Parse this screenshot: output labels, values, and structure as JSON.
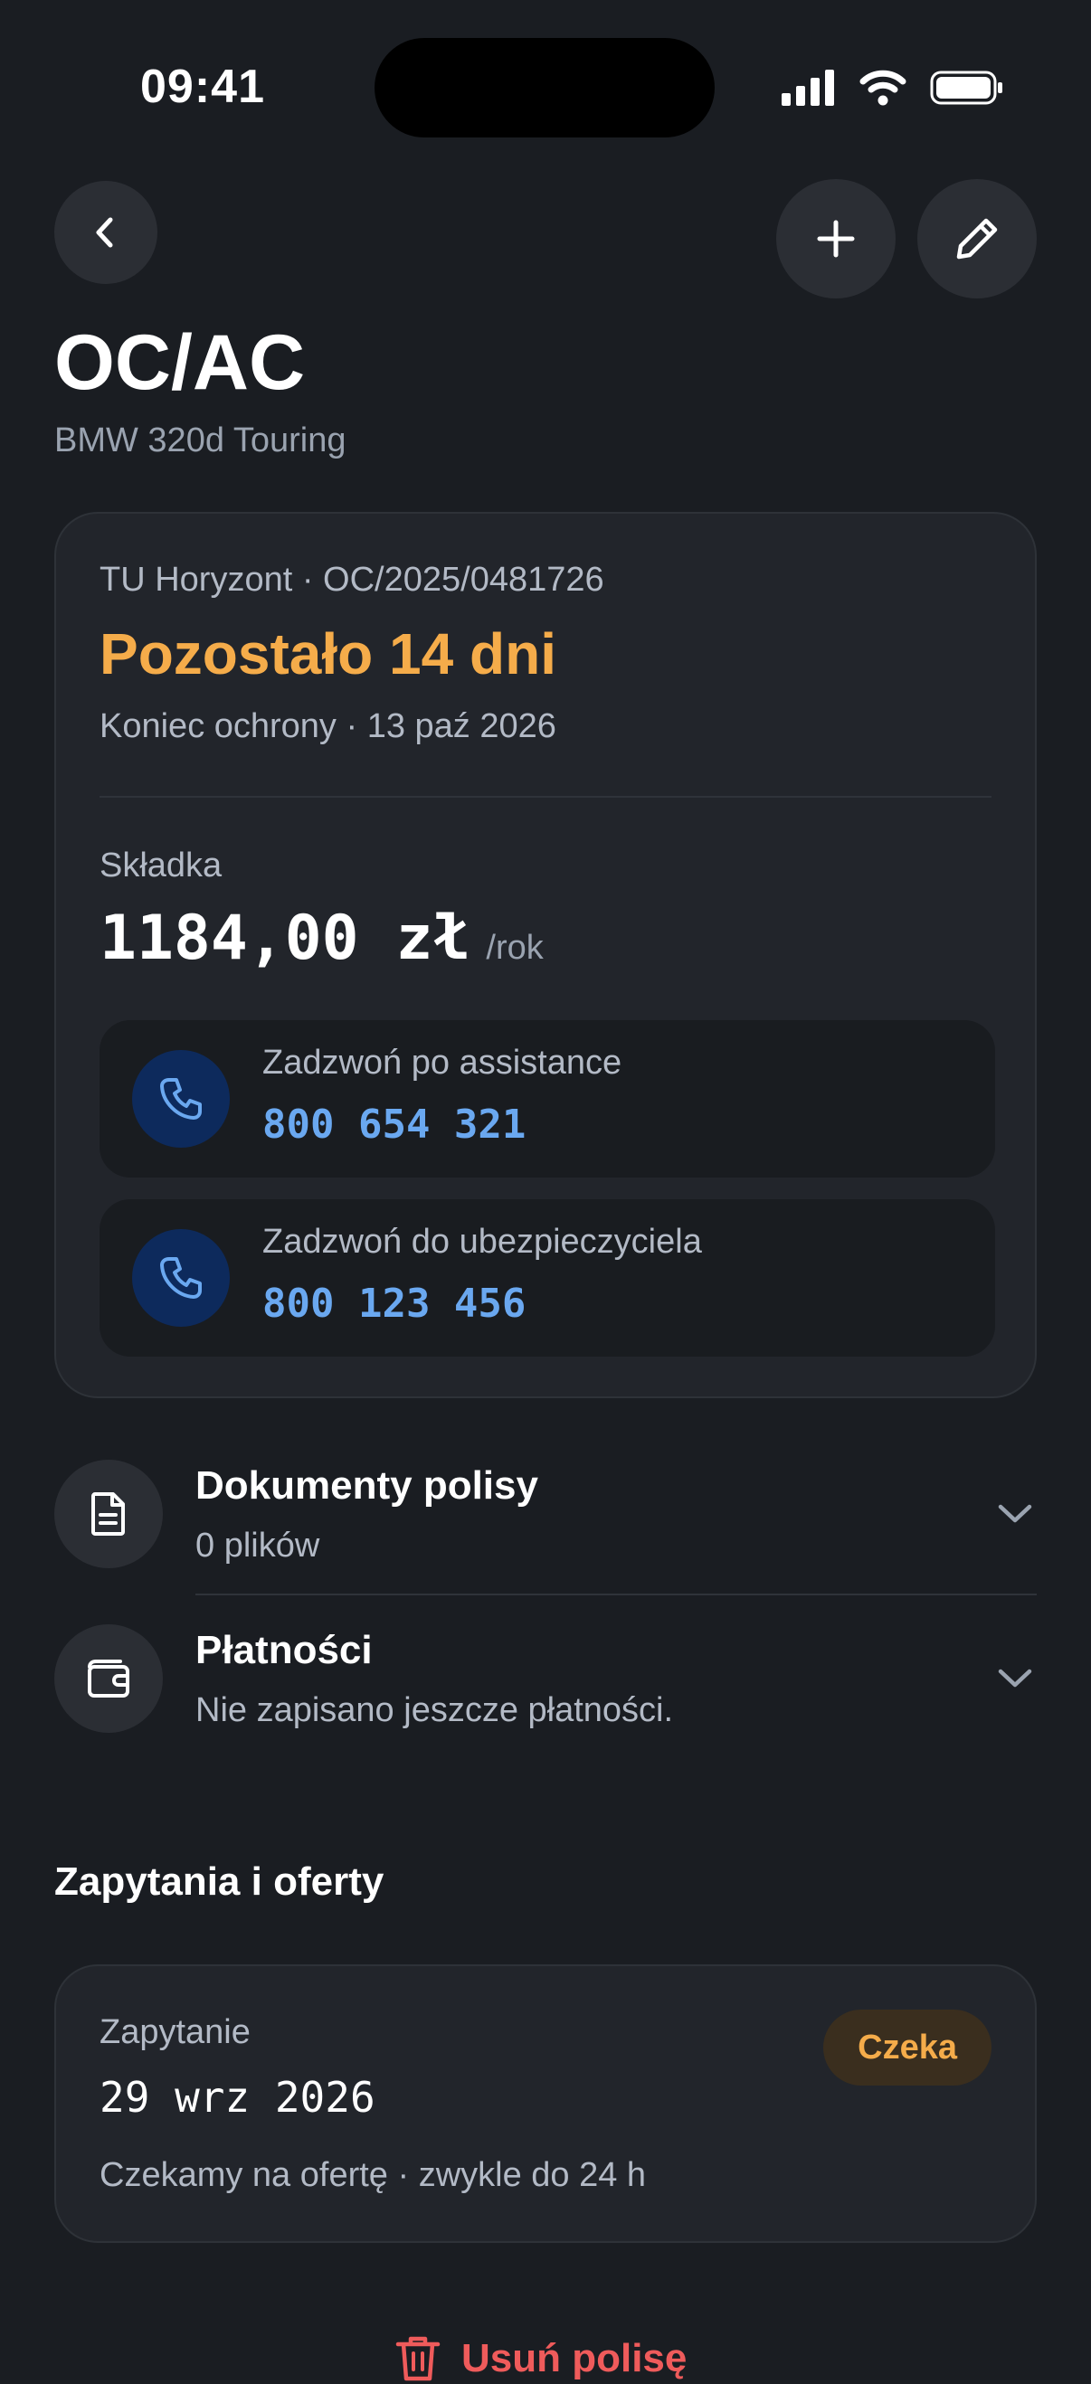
{
  "status_bar": {
    "time": "09:41"
  },
  "header": {
    "title": "OC/AC",
    "subtitle": "BMW 320d Touring"
  },
  "policy": {
    "insurer": "TU Horyzont · OC/2025/0481726",
    "remaining": "Pozostało 14 dni",
    "protection_end": "Koniec ochrony · 13 paź 2026",
    "premium_label": "Składka",
    "premium_value": "1184,00 zł",
    "premium_unit": "/rok"
  },
  "calls": [
    {
      "label": "Zadzwoń po assistance",
      "number": "800 654 321"
    },
    {
      "label": "Zadzwoń do ubezpieczyciela",
      "number": "800 123 456"
    }
  ],
  "sections": [
    {
      "title": "Dokumenty polisy",
      "subtitle": "0 plików"
    },
    {
      "title": "Płatności",
      "subtitle": "Nie zapisano jeszcze płatności."
    }
  ],
  "queries": {
    "heading": "Zapytania i oferty",
    "items": [
      {
        "label": "Zapytanie",
        "date": "29 wrz 2026",
        "note": "Czekamy na ofertę · zwykle do 24 h",
        "status": "Czeka"
      }
    ]
  },
  "actions": {
    "delete_label": "Usuń polisę"
  },
  "colors": {
    "accent_orange": "#f5ac4a",
    "phone_blue": "#6aa8f0",
    "danger": "#ef5b5b",
    "background": "#1a1d22"
  }
}
